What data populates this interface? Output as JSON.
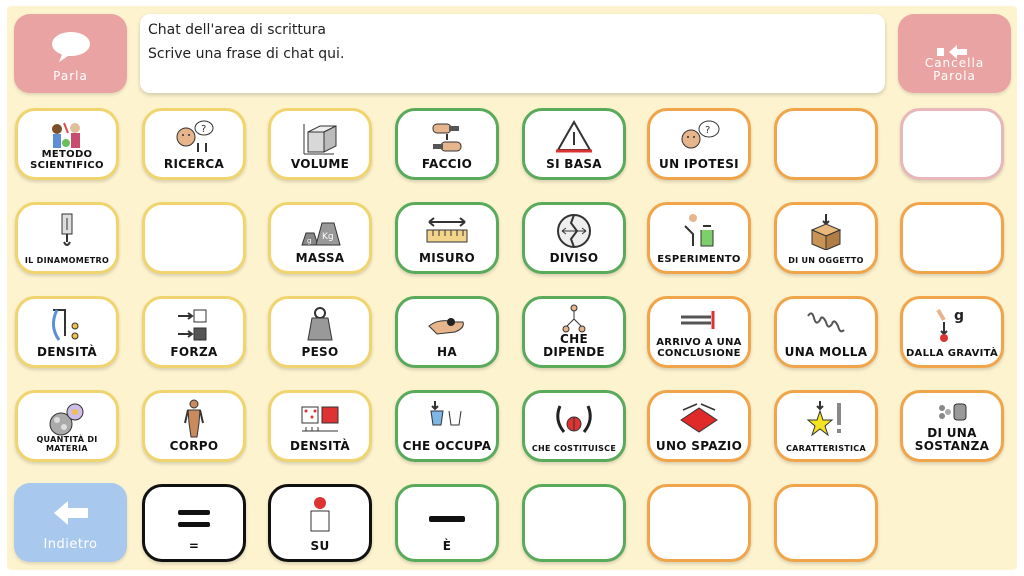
{
  "top": {
    "speak_label": "Parla",
    "clear_label": "Cancella Parola",
    "chat_line1": "Chat dell'area di scrittura",
    "chat_line2": "Scrive una frase di chat qui."
  },
  "grid": {
    "r1": [
      "METODO SCIENTIFICO",
      "RICERCA",
      "VOLUME",
      "FACCIO",
      "SI BASA",
      "UN IPOTESI",
      "",
      ""
    ],
    "r2": [
      "IL DINAMOMETRO",
      "",
      "MASSA",
      "MISURO",
      "DIVISO",
      "ESPERIMENTO",
      "DI UN OGGETTO",
      ""
    ],
    "r3": [
      "DENSITà",
      "FORZA",
      "PESO",
      "HA",
      "CHE DIPENDE",
      "ARRIVO A UNA CONCLUSIONE",
      "UNA MOLLA",
      "DALLA GRAVITà"
    ],
    "r4": [
      "QUANTITà DI MATERIA",
      "CORPO",
      "DENSITà",
      "CHE OCCUPA",
      "CHE COSTITUISCE",
      "UNO SPAZIO",
      "CARATTERISTICA",
      "DI UNA SOSTANZA"
    ],
    "r5": [
      "",
      "=",
      "SU",
      "è",
      "",
      "",
      ""
    ]
  },
  "nav": {
    "back_label": "Indietro"
  },
  "colors": {
    "board_bg": "#fdf3cf",
    "yellow_border": "#f0d56e",
    "green_border": "#5aaa5c",
    "orange_border": "#f0a54a",
    "pink_border": "#e8b7bc",
    "black_border": "#111111",
    "speak_button": "#eaa3a3",
    "back_button": "#a8c8ee"
  }
}
